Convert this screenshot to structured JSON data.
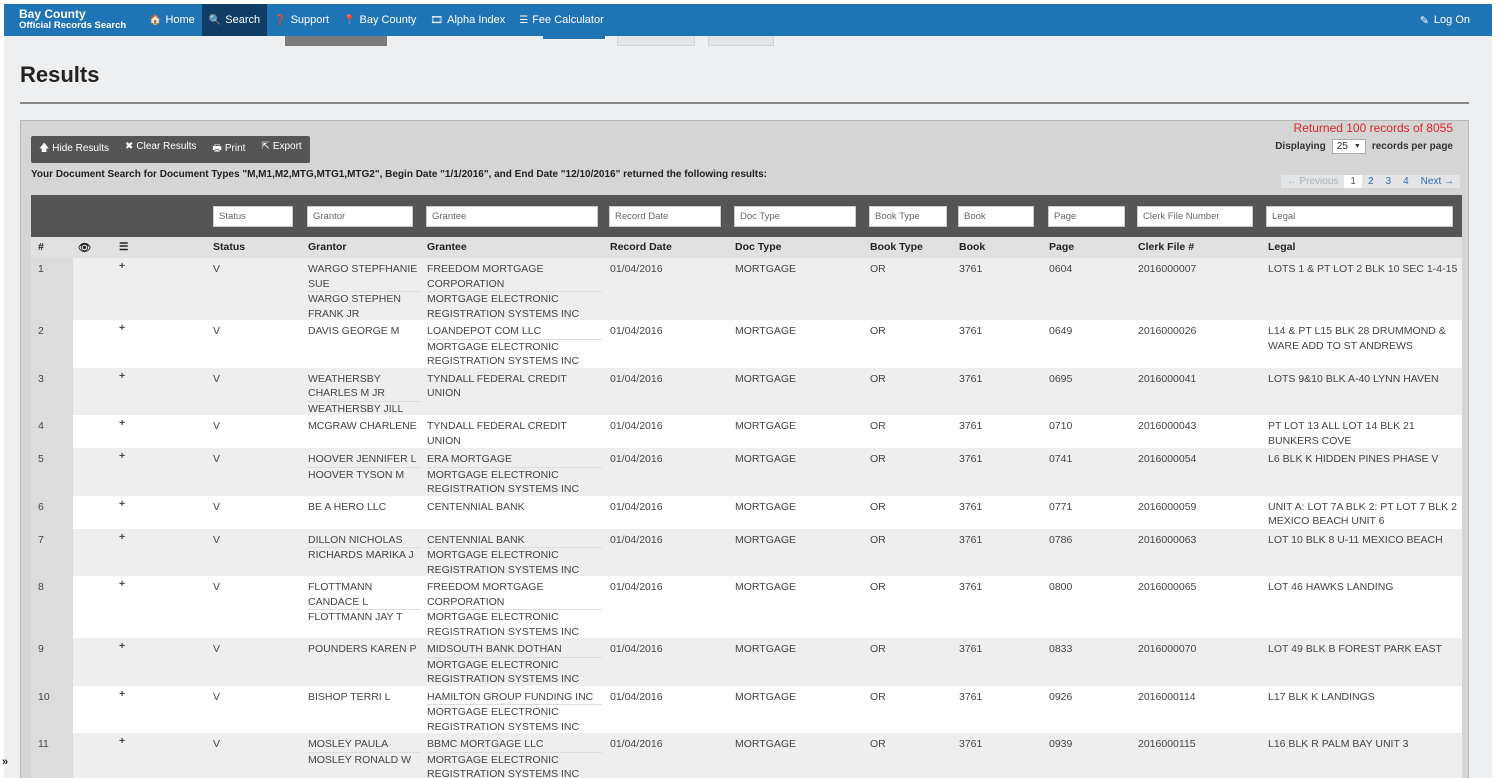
{
  "brand": {
    "line1": "Bay County",
    "line2": "Official Records Search"
  },
  "nav": [
    {
      "label": "Home",
      "icon": "🏠",
      "name": "nav-home",
      "active": false
    },
    {
      "label": "Search",
      "icon": "🔍",
      "name": "nav-search",
      "active": true
    },
    {
      "label": "Support",
      "icon": "❓",
      "name": "nav-support",
      "active": false
    },
    {
      "label": "Bay County",
      "icon": "📍",
      "name": "nav-bay-county",
      "active": false
    },
    {
      "label": "Alpha Index",
      "icon": "🎞",
      "name": "nav-alpha-index",
      "active": false
    },
    {
      "label": "Fee Calculator",
      "icon": "☰",
      "name": "nav-fee-calculator",
      "active": false
    }
  ],
  "login": {
    "label": "Log On",
    "icon": "✎"
  },
  "page": {
    "title": "Results"
  },
  "toolbar": {
    "hide": "Hide Results",
    "clear": "Clear Results",
    "print": "Print",
    "export": "Export"
  },
  "summary": {
    "returned": "Returned 100 records of 8055",
    "displaying_prefix": "Displaying",
    "per_page": "25",
    "displaying_suffix": "records per page",
    "description": "Your Document Search for Document Types \"M,M1,M2,MTG,MTG1,MTG2\", Begin Date \"1/1/2016\", and End Date \"12/10/2016\" returned the following results:"
  },
  "pager": {
    "prev": "← Previous",
    "pages": [
      "1",
      "2",
      "3",
      "4"
    ],
    "next": "Next →"
  },
  "filters": [
    "Status",
    "Grantor",
    "Grantee",
    "Record Date",
    "Doc Type",
    "Book Type",
    "Book",
    "Page",
    "Clerk File Number",
    "Legal"
  ],
  "headers": {
    "num": "#",
    "eye": "👁",
    "list": "☰",
    "status": "Status",
    "grantor": "Grantor",
    "grantee": "Grantee",
    "record_date": "Record Date",
    "doc_type": "Doc Type",
    "book_type": "Book Type",
    "book": "Book",
    "page": "Page",
    "clerk": "Clerk File #",
    "legal": "Legal"
  },
  "rows": [
    {
      "num": "1",
      "status": "V",
      "grantor": [
        "WARGO STEPFHANIE SUE",
        "WARGO STEPHEN FRANK JR"
      ],
      "grantee": [
        "FREEDOM MORTGAGE CORPORATION",
        "MORTGAGE ELECTRONIC REGISTRATION SYSTEMS INC"
      ],
      "record_date": "01/04/2016",
      "doc_type": "MORTGAGE",
      "book_type": "OR",
      "book": "3761",
      "page": "0604",
      "clerk": "2016000007",
      "legal": "LOTS 1 & PT LOT 2 BLK 10 SEC 1-4-15"
    },
    {
      "num": "2",
      "status": "V",
      "grantor": [
        "DAVIS GEORGE M"
      ],
      "grantee": [
        "LOANDEPOT COM LLC",
        "MORTGAGE ELECTRONIC REGISTRATION SYSTEMS INC"
      ],
      "record_date": "01/04/2016",
      "doc_type": "MORTGAGE",
      "book_type": "OR",
      "book": "3761",
      "page": "0649",
      "clerk": "2016000026",
      "legal": "L14 & PT L15 BLK 28 DRUMMOND & WARE ADD TO ST ANDREWS"
    },
    {
      "num": "3",
      "status": "V",
      "grantor": [
        "WEATHERSBY CHARLES M JR",
        "WEATHERSBY JILL"
      ],
      "grantee": [
        "TYNDALL FEDERAL CREDIT UNION"
      ],
      "record_date": "01/04/2016",
      "doc_type": "MORTGAGE",
      "book_type": "OR",
      "book": "3761",
      "page": "0695",
      "clerk": "2016000041",
      "legal": "LOTS 9&10 BLK A-40 LYNN HAVEN"
    },
    {
      "num": "4",
      "status": "V",
      "grantor": [
        "MCGRAW CHARLENE"
      ],
      "grantee": [
        "TYNDALL FEDERAL CREDIT UNION"
      ],
      "record_date": "01/04/2016",
      "doc_type": "MORTGAGE",
      "book_type": "OR",
      "book": "3761",
      "page": "0710",
      "clerk": "2016000043",
      "legal": "PT LOT 13 ALL LOT 14 BLK 21 BUNKERS COVE"
    },
    {
      "num": "5",
      "status": "V",
      "grantor": [
        "HOOVER JENNIFER L",
        "HOOVER TYSON M"
      ],
      "grantee": [
        "ERA MORTGAGE",
        "MORTGAGE ELECTRONIC REGISTRATION SYSTEMS INC"
      ],
      "record_date": "01/04/2016",
      "doc_type": "MORTGAGE",
      "book_type": "OR",
      "book": "3761",
      "page": "0741",
      "clerk": "2016000054",
      "legal": "L6 BLK K HIDDEN PINES PHASE V"
    },
    {
      "num": "6",
      "status": "V",
      "grantor": [
        "BE A HERO LLC"
      ],
      "grantee": [
        "CENTENNIAL BANK"
      ],
      "record_date": "01/04/2016",
      "doc_type": "MORTGAGE",
      "book_type": "OR",
      "book": "3761",
      "page": "0771",
      "clerk": "2016000059",
      "legal": "UNIT A: LOT 7A BLK 2: PT LOT 7 BLK 2 MEXICO BEACH UNIT 6"
    },
    {
      "num": "7",
      "status": "V",
      "grantor": [
        "DILLON NICHOLAS",
        "RICHARDS MARIKA J"
      ],
      "grantee": [
        "CENTENNIAL BANK",
        "MORTGAGE ELECTRONIC REGISTRATION SYSTEMS INC"
      ],
      "record_date": "01/04/2016",
      "doc_type": "MORTGAGE",
      "book_type": "OR",
      "book": "3761",
      "page": "0786",
      "clerk": "2016000063",
      "legal": "LOT 10 BLK 8 U-11 MEXICO BEACH"
    },
    {
      "num": "8",
      "status": "V",
      "grantor": [
        "FLOTTMANN CANDACE L",
        "FLOTTMANN JAY T"
      ],
      "grantee": [
        "FREEDOM MORTGAGE CORPORATION",
        "MORTGAGE ELECTRONIC REGISTRATION SYSTEMS INC"
      ],
      "record_date": "01/04/2016",
      "doc_type": "MORTGAGE",
      "book_type": "OR",
      "book": "3761",
      "page": "0800",
      "clerk": "2016000065",
      "legal": "LOT 46 HAWKS LANDING"
    },
    {
      "num": "9",
      "status": "V",
      "grantor": [
        "POUNDERS KAREN P"
      ],
      "grantee": [
        "MIDSOUTH BANK DOTHAN",
        "MORTGAGE ELECTRONIC REGISTRATION SYSTEMS INC"
      ],
      "record_date": "01/04/2016",
      "doc_type": "MORTGAGE",
      "book_type": "OR",
      "book": "3761",
      "page": "0833",
      "clerk": "2016000070",
      "legal": "LOT 49 BLK B FOREST PARK EAST"
    },
    {
      "num": "10",
      "status": "V",
      "grantor": [
        "BISHOP TERRI L"
      ],
      "grantee": [
        "HAMILTON GROUP FUNDING INC",
        "MORTGAGE ELECTRONIC REGISTRATION SYSTEMS INC"
      ],
      "record_date": "01/04/2016",
      "doc_type": "MORTGAGE",
      "book_type": "OR",
      "book": "3761",
      "page": "0926",
      "clerk": "2016000114",
      "legal": "L17 BLK K LANDINGS"
    },
    {
      "num": "11",
      "status": "V",
      "grantor": [
        "MOSLEY PAULA",
        "MOSLEY RONALD W"
      ],
      "grantee": [
        "BBMC MORTGAGE LLC",
        "MORTGAGE ELECTRONIC REGISTRATION SYSTEMS INC"
      ],
      "record_date": "01/04/2016",
      "doc_type": "MORTGAGE",
      "book_type": "OR",
      "book": "3761",
      "page": "0939",
      "clerk": "2016000115",
      "legal": "L16 BLK R PALM BAY UNIT 3"
    }
  ],
  "expander": "»",
  "colors": {
    "navbar": "#1f74b5",
    "nav_active": "#0f3d66",
    "returned": "#d9232e",
    "plus": "#2f7fc3"
  }
}
